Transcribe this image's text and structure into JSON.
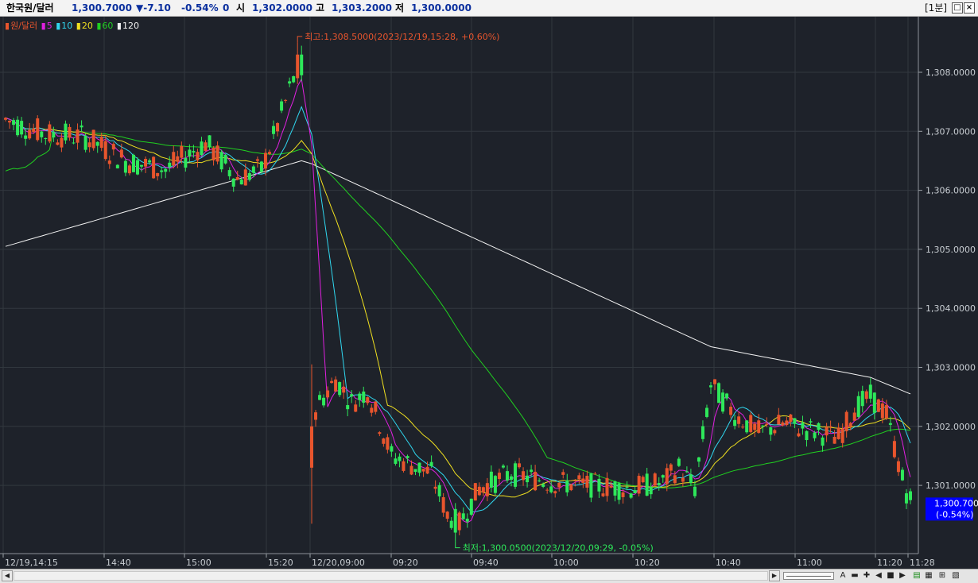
{
  "header": {
    "instrument": "한국원/달러",
    "price": "1,300.7000",
    "change": "▼-7.10",
    "change_pct": "-0.54%",
    "volume": "0",
    "open_label": "시",
    "open": "1,302.0000",
    "high_label": "고",
    "high": "1,303.2000",
    "low_label": "저",
    "low": "1,300.0000",
    "timeframe": "[1분]"
  },
  "legend": {
    "series_label": "원/달러",
    "ma5": "5",
    "ma10": "10",
    "ma20": "20",
    "ma60": "60",
    "ma120": "120"
  },
  "annotations": {
    "high": "최고:1,308.5000(2023/12/19,15:28, +0.60%)",
    "low": "최저:1,300.0500(2023/12/20,09:29, -0.05%)"
  },
  "current_price": {
    "value": "1,300.7000",
    "pct": "(-0.54%)"
  },
  "window_buttons": [
    "□",
    "×"
  ],
  "toolbar": [
    "A",
    "▬",
    "✚",
    "◀",
    "■",
    "▶",
    "▤",
    "▦",
    "⊞",
    "▧"
  ],
  "colors": {
    "background": "#1e222a",
    "grid": "#32383f",
    "up": "#e8552d",
    "down": "#2ee85a",
    "ma5": "#e020e0",
    "ma10": "#30d8f0",
    "ma20": "#f0e020",
    "ma60": "#20d020",
    "ma120": "#f2f2f2",
    "accent": "#0000ff"
  },
  "chart_data": {
    "type": "candlestick",
    "y_ticks": [
      "1,308.0000",
      "1,307.0000",
      "1,306.0000",
      "1,305.0000",
      "1,304.0000",
      "1,303.0000",
      "1,302.0000",
      "1,301.0000"
    ],
    "x_ticks": [
      "12/19,14:15",
      "14:40",
      "15:00",
      "15:20",
      "12/20,09:00",
      "09:20",
      "09:40",
      "10:00",
      "10:20",
      "10:40",
      "11:00",
      "11:20",
      "11:28"
    ],
    "ylim": [
      1299.8,
      1308.95
    ],
    "high": 1308.5,
    "low": 1300.05,
    "last": 1300.7,
    "grid": true
  }
}
